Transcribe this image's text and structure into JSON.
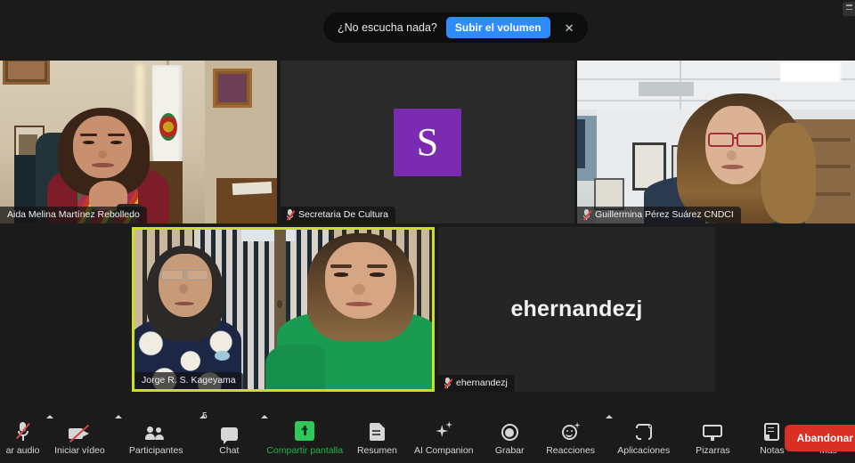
{
  "toast": {
    "message": "¿No escucha nada?",
    "action_label": "Subir el volumen",
    "close_icon": "close-icon",
    "action_color": "#2d8cff"
  },
  "meeting": {
    "participant_count": "5",
    "active_speaker_border_color": "#cde01e",
    "tiles": [
      {
        "id": "tile-1",
        "name": "Aida Melina Martínez Rebolledo",
        "muted": false,
        "video_on": true,
        "active_speaker": false,
        "placeholder": ""
      },
      {
        "id": "tile-2",
        "name": "Secretaria De Cultura",
        "muted": true,
        "video_on": false,
        "active_speaker": false,
        "placeholder": "S",
        "avatar_color": "#7b2baf"
      },
      {
        "id": "tile-3",
        "name": "Guillermina Pérez Suárez CNDCI",
        "muted": true,
        "video_on": true,
        "active_speaker": false,
        "placeholder": ""
      },
      {
        "id": "tile-4",
        "name": "Jorge R. S. Kageyama",
        "muted": false,
        "video_on": true,
        "active_speaker": true,
        "placeholder": ""
      },
      {
        "id": "tile-5",
        "name": "ehernandezj",
        "muted": true,
        "video_on": false,
        "active_speaker": false,
        "placeholder": "ehernandezj"
      }
    ]
  },
  "toolbar": {
    "items": [
      {
        "label": "ar audio",
        "icon": "microphone-muted-icon",
        "caret": true,
        "badge": "",
        "accent": ""
      },
      {
        "label": "Iniciar vídeo",
        "icon": "camera-muted-icon",
        "caret": true,
        "badge": "",
        "accent": ""
      },
      {
        "label": "Participantes",
        "icon": "participants-icon",
        "caret": true,
        "badge": "5",
        "accent": ""
      },
      {
        "label": "Chat",
        "icon": "chat-icon",
        "caret": true,
        "badge": "",
        "accent": ""
      },
      {
        "label": "Compartir pantalla",
        "icon": "share-screen-icon",
        "caret": false,
        "badge": "",
        "accent": "#25b34b"
      },
      {
        "label": "Resumen",
        "icon": "summary-doc-icon",
        "caret": false,
        "badge": "",
        "accent": ""
      },
      {
        "label": "AI Companion",
        "icon": "sparkle-icon",
        "caret": false,
        "badge": "",
        "accent": ""
      },
      {
        "label": "Grabar",
        "icon": "record-icon",
        "caret": false,
        "badge": "",
        "accent": ""
      },
      {
        "label": "Reacciones",
        "icon": "reactions-emoji-icon",
        "caret": true,
        "badge": "",
        "accent": ""
      },
      {
        "label": "Aplicaciones",
        "icon": "apps-icon",
        "caret": false,
        "badge": "",
        "accent": ""
      },
      {
        "label": "Pizarras",
        "icon": "whiteboard-icon",
        "caret": false,
        "badge": "",
        "accent": ""
      },
      {
        "label": "Notas",
        "icon": "notes-icon",
        "caret": false,
        "badge": "",
        "accent": ""
      },
      {
        "label": "Más",
        "icon": "more-dots-icon",
        "caret": false,
        "badge": "",
        "accent": ""
      }
    ],
    "leave_label": "Abandonar",
    "leave_color": "#d93025"
  }
}
